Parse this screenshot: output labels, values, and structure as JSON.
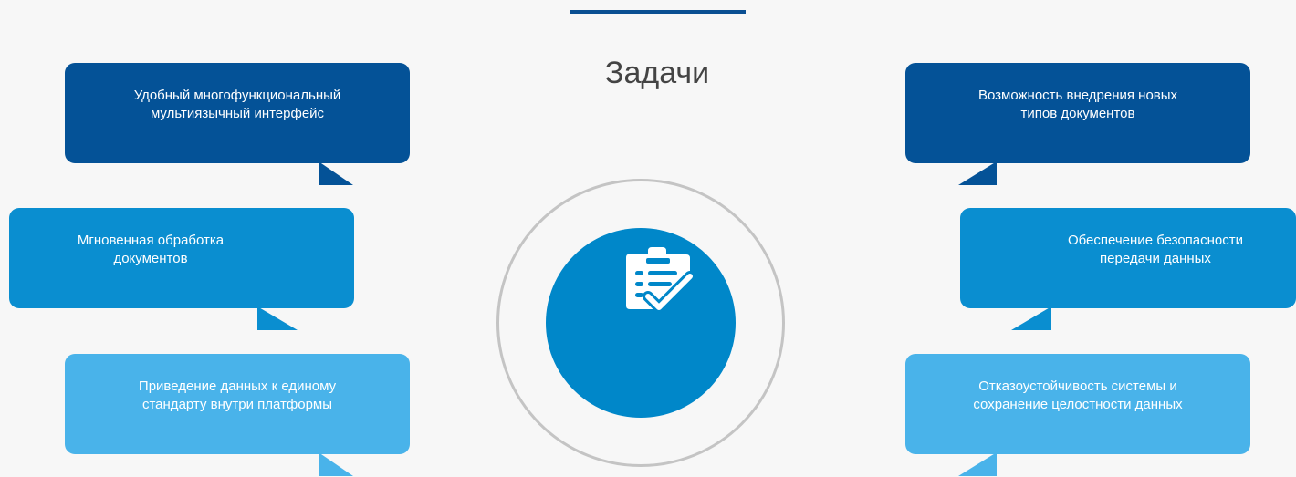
{
  "title": "Задачи",
  "colors": {
    "top_bar": "#0a4f92",
    "dark_bubble": "#045297",
    "mid_bubble": "#0a8ed0",
    "light_bubble": "#49b3ea",
    "center_circle": "#0087c9",
    "ring": "#c4c4c4",
    "background": "#f7f7f7"
  },
  "center_icon": "clipboard-check-icon",
  "left_items": [
    {
      "line1": "Удобный многофункциональный",
      "line2": "мультиязычный интерфейс"
    },
    {
      "line1": "Мгновенная обработка",
      "line2": "документов"
    },
    {
      "line1": "Приведение данных к единому",
      "line2": "стандарту внутри платформы"
    }
  ],
  "right_items": [
    {
      "line1": "Возможность внедрения новых",
      "line2": "типов документов"
    },
    {
      "line1": "Обеспечение безопасности",
      "line2": "передачи данных"
    },
    {
      "line1": "Отказоустойчивость системы и",
      "line2": "сохранение целостности данных"
    }
  ]
}
